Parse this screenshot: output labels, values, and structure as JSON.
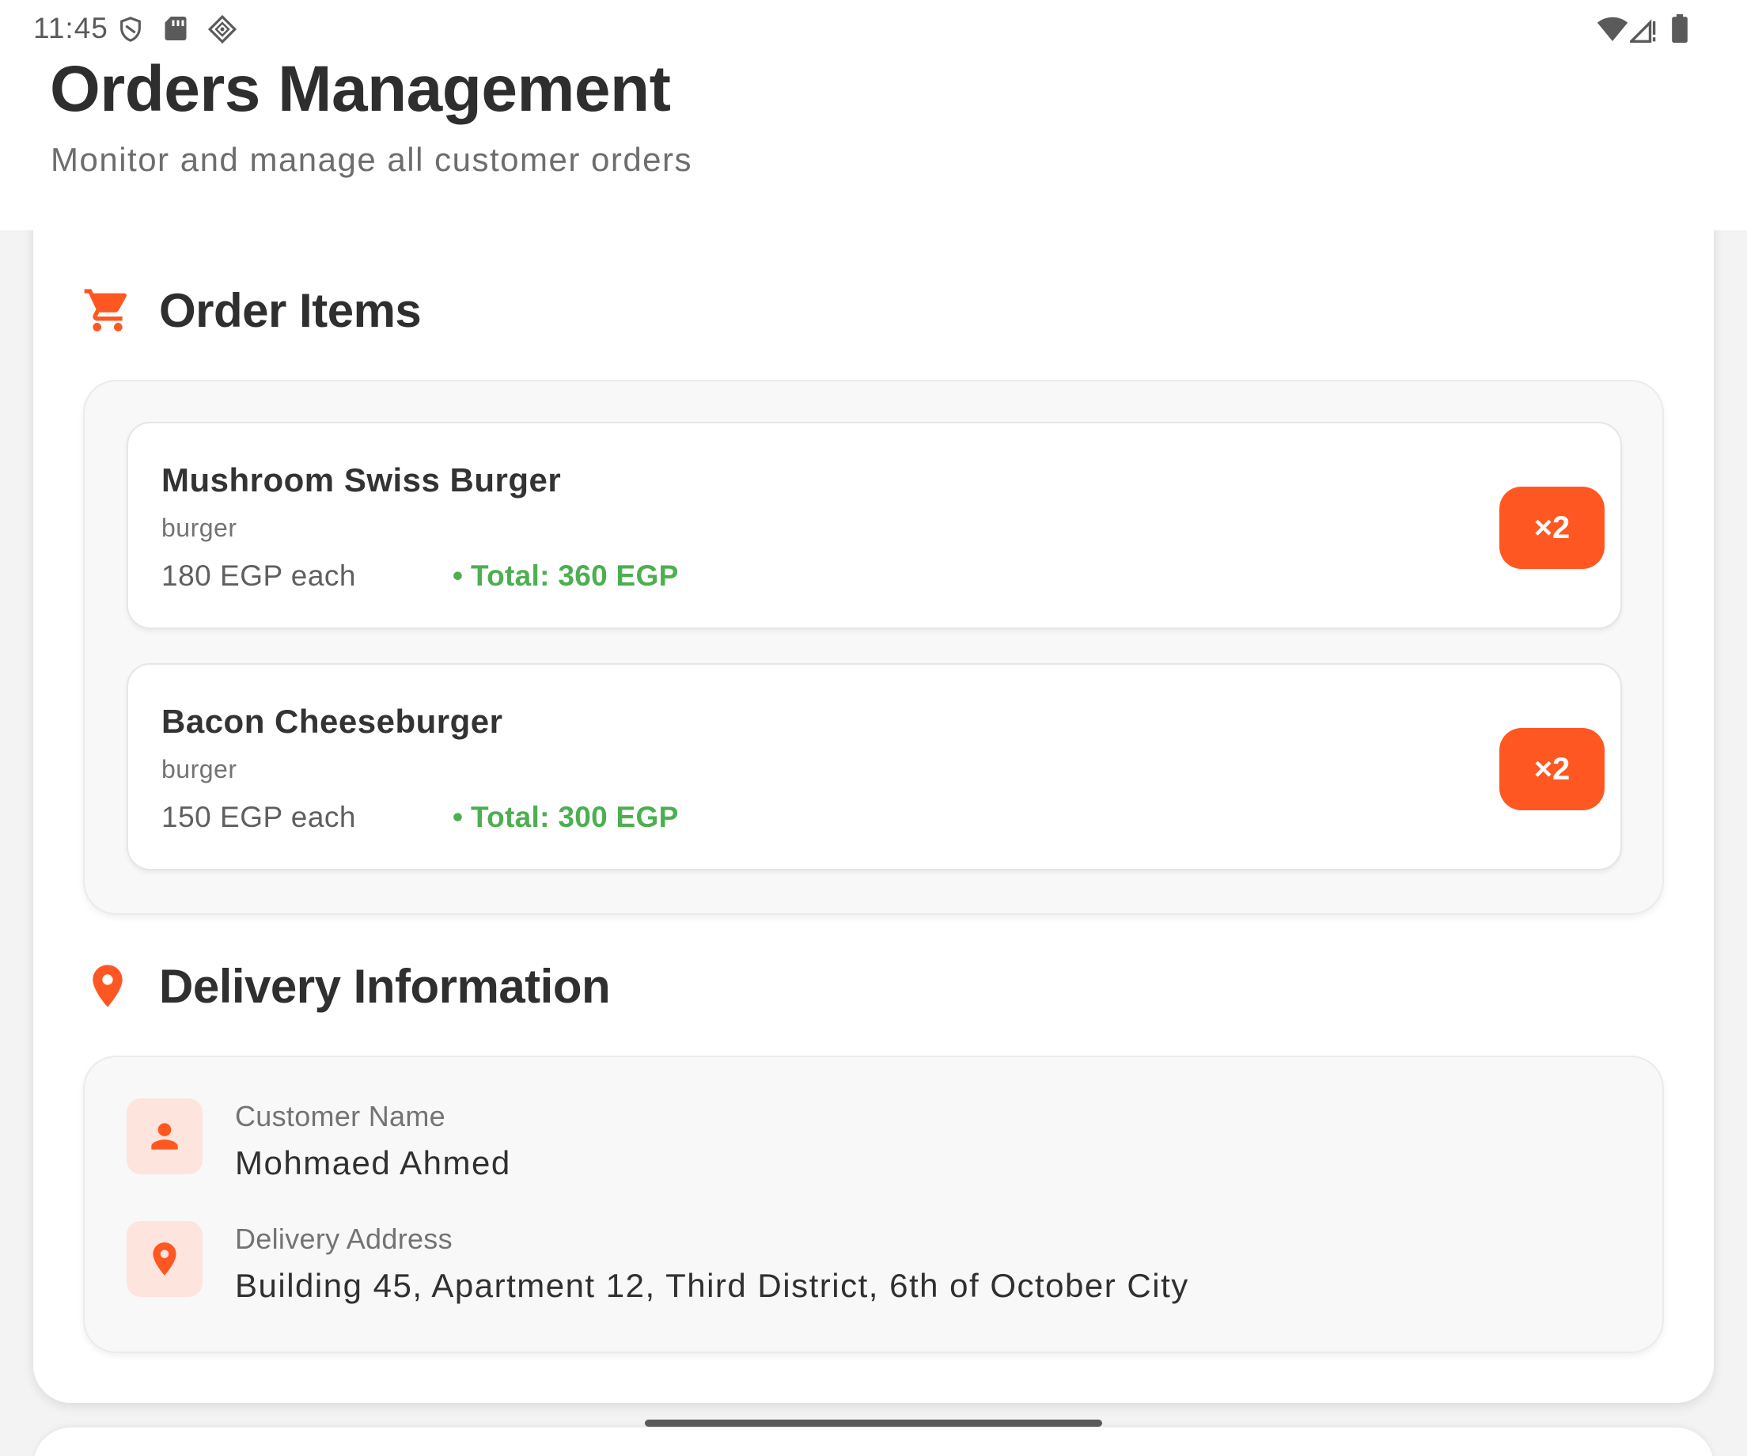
{
  "status_bar": {
    "time": "11:45",
    "left_icons": [
      "shield-icon",
      "sd-card-icon",
      "cast-icon"
    ],
    "right_icons": [
      "wifi-icon",
      "signal-icon",
      "battery-icon"
    ]
  },
  "header": {
    "title": "Orders Management",
    "subtitle": "Monitor and manage all customer orders"
  },
  "order_items": {
    "title": "Order Items",
    "icon": "cart-icon",
    "items": [
      {
        "name": "Mushroom Swiss Burger",
        "category": "burger",
        "price": "180 EGP each",
        "separator": "•",
        "total": "Total: 360 EGP",
        "quantity": "×2"
      },
      {
        "name": "Bacon Cheeseburger",
        "category": "burger",
        "price": "150 EGP each",
        "separator": "•",
        "total": "Total: 300 EGP",
        "quantity": "×2"
      }
    ]
  },
  "delivery": {
    "title": "Delivery Information",
    "icon": "location-pin-icon",
    "customer_label": "Customer Name",
    "customer_value": "Mohmaed Ahmed",
    "customer_icon": "person-icon",
    "address_label": "Delivery Address",
    "address_value": "Building 45, Apartment 12, Third District, 6th of October City",
    "address_icon": "location-pin-icon"
  },
  "colors": {
    "accent": "#ff5722",
    "accent_light": "#fde4dc",
    "total_green": "#4caf50",
    "text_dark": "#2e2e2e",
    "text_muted": "#737373"
  }
}
